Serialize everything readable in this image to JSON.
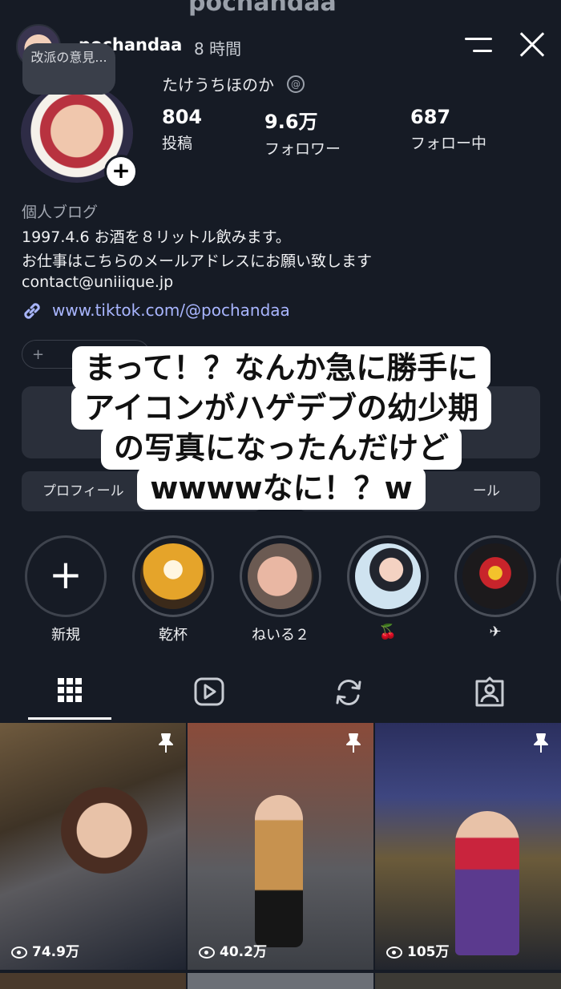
{
  "story_header": {
    "username": "pochandaa",
    "time_ago": "8 時間",
    "ghost_title": "pochandaa"
  },
  "note_bubble": "改派の意見...",
  "profile": {
    "display_name": "たけうちほのか",
    "stats": [
      {
        "value": "804",
        "label": "投稿"
      },
      {
        "value": "9.6万",
        "label": "フォロワー"
      },
      {
        "value": "687",
        "label": "フォロー中"
      }
    ],
    "category": "個人ブログ",
    "bio_lines": [
      "1997.4.6 お酒を８リットル飲みます。",
      "お仕事はこちらのメールアドレスにお願い致します",
      "contact@uniiique.jp"
    ],
    "link": "www.tiktok.com/@pochandaa"
  },
  "hidden_buttons": {
    "chip": "+",
    "left": "プロフィール",
    "right": "ール"
  },
  "overlay_caption": [
    "まって！？なんか急に勝手に",
    "アイコンがハゲデブの幼少期",
    "の写真になったんだけど",
    "wwwwなに！？w"
  ],
  "highlights": [
    {
      "label": "新規",
      "icon": "plus-icon"
    },
    {
      "label": "乾杯",
      "icon": "beer-photo"
    },
    {
      "label": "ねいる２",
      "icon": "nails-photo"
    },
    {
      "label": "🍒",
      "icon": "selfie-photo"
    },
    {
      "label": "✈",
      "icon": "sign-photo"
    }
  ],
  "tabs": [
    {
      "name": "grid",
      "icon": "grid-icon",
      "active": true
    },
    {
      "name": "reels",
      "icon": "reels-icon"
    },
    {
      "name": "reposts",
      "icon": "repost-icon"
    },
    {
      "name": "tagged",
      "icon": "tagged-icon"
    }
  ],
  "posts": [
    {
      "views": "74.9万",
      "pinned": true
    },
    {
      "views": "40.2万",
      "pinned": true
    },
    {
      "views": "105万",
      "pinned": true
    }
  ],
  "colors": {
    "background": "#161b25",
    "link": "#a9b6ff",
    "caption_bg": "#ffffff"
  }
}
